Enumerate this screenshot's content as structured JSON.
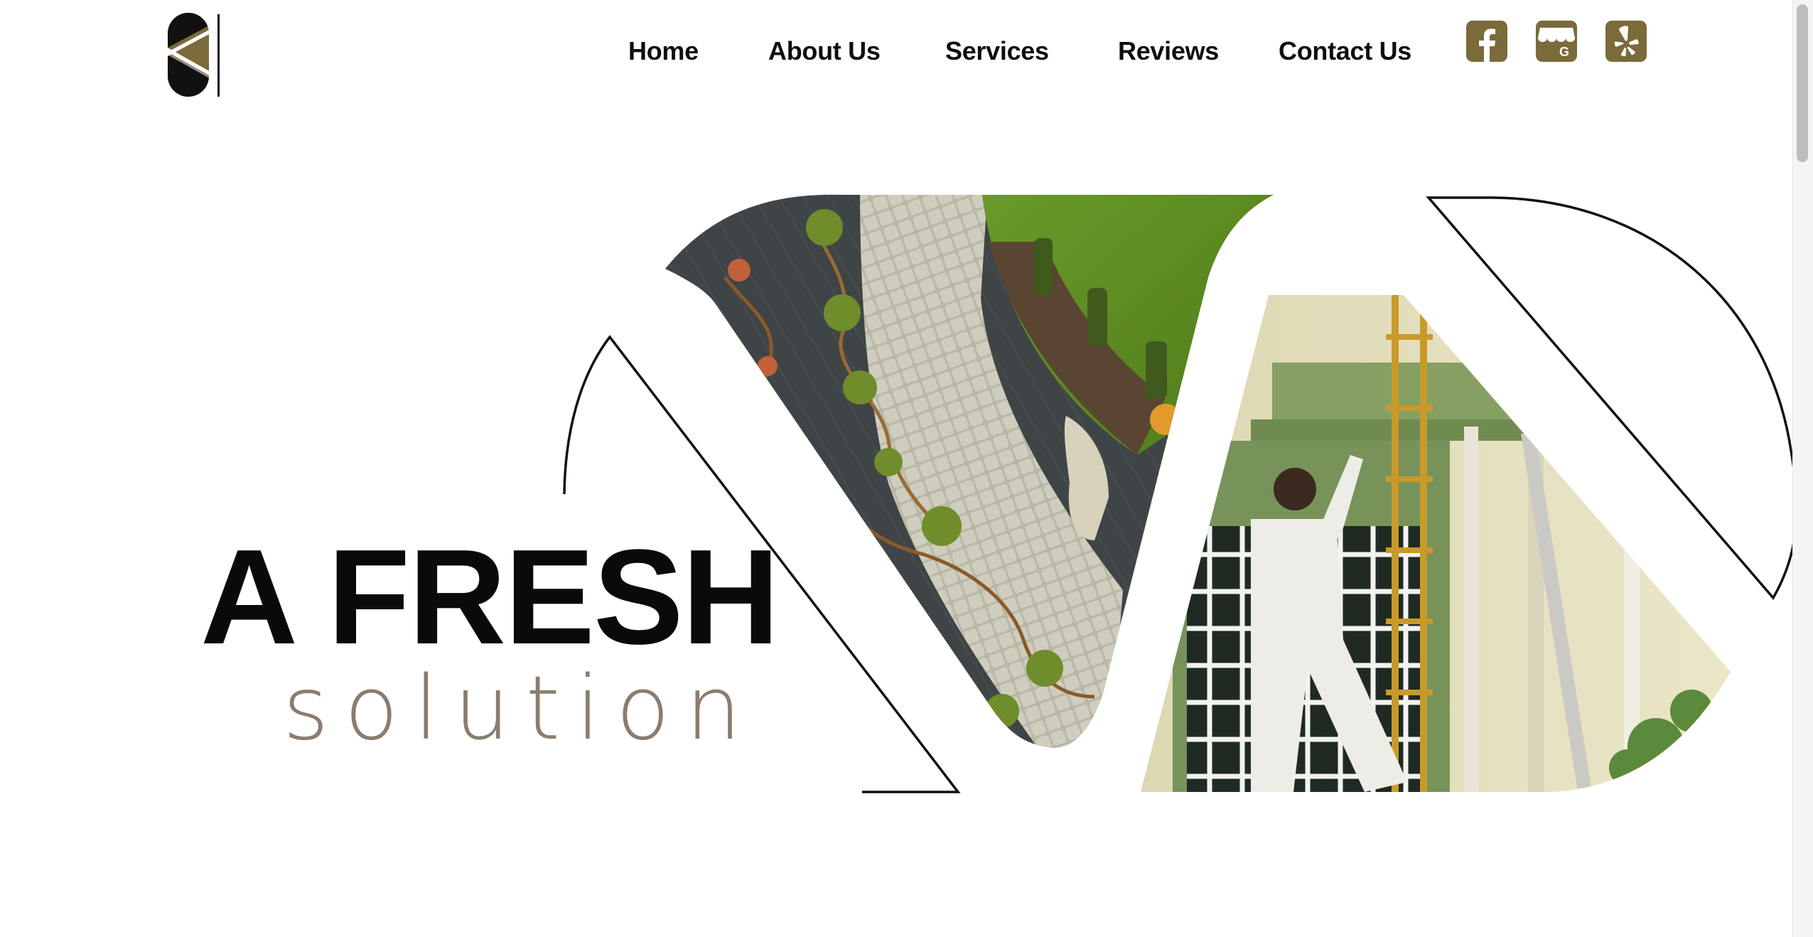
{
  "brand": {
    "color": "#7b6a3a",
    "accent_text": "#8a7d6e",
    "logo_icon": "leaf-pill-logo-icon"
  },
  "nav": {
    "items": [
      {
        "label": "Home"
      },
      {
        "label": "About Us"
      },
      {
        "label": "Services"
      },
      {
        "label": "Reviews"
      },
      {
        "label": "Contact Us"
      }
    ]
  },
  "social": [
    {
      "icon": "facebook-icon"
    },
    {
      "icon": "google-business-icon"
    },
    {
      "icon": "yelp-icon"
    }
  ],
  "hero": {
    "headline": "A FRESH",
    "subline": "solution",
    "images": [
      "landscaping-photo",
      "painting-photo"
    ]
  }
}
